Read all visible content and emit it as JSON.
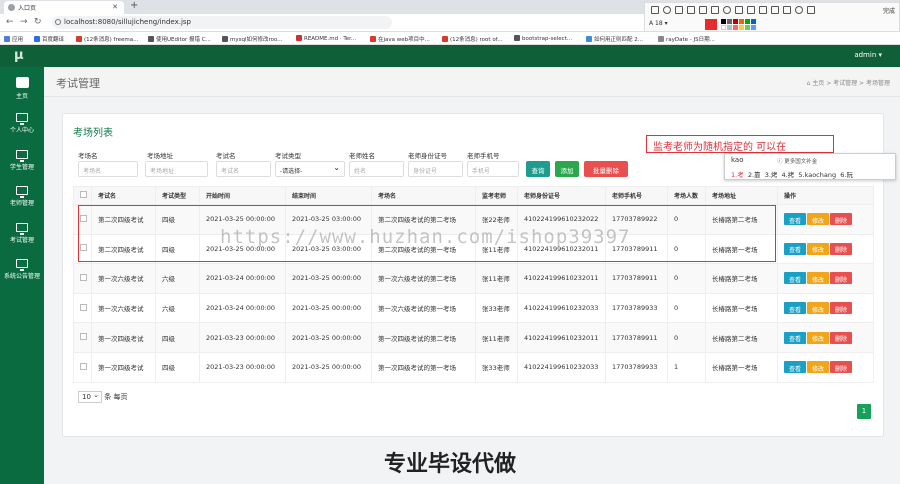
{
  "browser": {
    "tab_title": "入口页",
    "url": "localhost:8080/sillujicheng/index.jsp",
    "bookmarks": [
      "应用",
      "百度翻译",
      "(12条消息) freema...",
      "使用UEditor 报错 C...",
      "mysql如何修改roo...",
      "README.md · Ter...",
      "在java web项目中...",
      "(12条消息) root of...",
      "bootstrap-select...",
      "如何用正则匹配 2...",
      "rayDate - JS日期..."
    ]
  },
  "annotation_toolbar": {
    "font_size": "18",
    "done_label": "完成",
    "color": "#e52b2b"
  },
  "header": {
    "logo": "μ",
    "user": "admin ▾"
  },
  "sidebar": {
    "items": [
      {
        "label": "主页"
      },
      {
        "label": "个人中心"
      },
      {
        "label": "学生管理"
      },
      {
        "label": "老师管理"
      },
      {
        "label": "考试管理"
      },
      {
        "label": "系统公告管理"
      }
    ]
  },
  "page": {
    "title": "考试管理",
    "breadcrumb": "⌂ 主页  >  考试管理  >  考场管理"
  },
  "panel": {
    "title": "考场列表",
    "filters": [
      {
        "label": "考场名",
        "placeholder": "考场名"
      },
      {
        "label": "考场地址",
        "placeholder": "考场地址"
      },
      {
        "label": "考试名",
        "placeholder": "考试名"
      },
      {
        "label": "考试类型",
        "value": "-请选择-"
      },
      {
        "label": "老师姓名",
        "placeholder": "姓名"
      },
      {
        "label": "老师身份证号",
        "placeholder": "身份证号"
      },
      {
        "label": "老师手机号",
        "placeholder": "手机号"
      }
    ],
    "buttons": {
      "search": "查询",
      "add": "添加",
      "batch_delete": "批量删除"
    },
    "columns": [
      "",
      "考试名",
      "考试类型",
      "开始时间",
      "结束时间",
      "考场名",
      "监考老师",
      "老师身份证号",
      "老师手机号",
      "考场人数",
      "考场地址",
      "操作"
    ],
    "rows": [
      [
        "第二次四级考试",
        "四级",
        "2021-03-25 00:00:00",
        "2021-03-25 03:00:00",
        "第二次四级考试的第二考场",
        "张22老师",
        "410224199610232022",
        "17703789922",
        "0",
        "长椿路第二考场"
      ],
      [
        "第二次四级考试",
        "四级",
        "2021-03-25 00:00:00",
        "2021-03-25 03:00:00",
        "第二次四级考试的第一考场",
        "张11老师",
        "410224199610232011",
        "17703789911",
        "0",
        "长椿路第一考场"
      ],
      [
        "第一次六级考试",
        "六级",
        "2021-03-24 00:00:00",
        "2021-03-25 00:00:00",
        "第一次六级考试的第二考场",
        "张11老师",
        "410224199610232011",
        "17703789911",
        "0",
        "长椿路第二考场"
      ],
      [
        "第一次六级考试",
        "六级",
        "2021-03-24 00:00:00",
        "2021-03-25 00:00:00",
        "第一次六级考试的第一考场",
        "张33老师",
        "410224199610232033",
        "17703789933",
        "0",
        "长椿路第一考场"
      ],
      [
        "第一次四级考试",
        "四级",
        "2021-03-23 00:00:00",
        "2021-03-25 00:00:00",
        "第一次四级考试的第二考场",
        "张11老师",
        "410224199610232011",
        "17703789911",
        "0",
        "长椿路第二考场"
      ],
      [
        "第一次四级考试",
        "四级",
        "2021-03-23 00:00:00",
        "2021-03-25 00:00:00",
        "第一次四级考试的第一考场",
        "张33老师",
        "410224199610232033",
        "17703789933",
        "1",
        "长椿路第一考场"
      ]
    ],
    "row_actions": {
      "view": "查看",
      "edit": "修改",
      "delete": "删除"
    },
    "page_size": "10",
    "page_size_suffix": "条 每页",
    "current_page": "1"
  },
  "overlay": {
    "note": "监考老师为随机指定的  可以在",
    "ime_input": "kao",
    "ime_hint": "ⓘ 更多国文补金",
    "ime_candidates": [
      "1.考",
      "2.靠",
      "3.烤",
      "4.拷",
      "5.kaochang",
      "6.阮"
    ]
  },
  "watermark": "https://www.huzhan.com/ishop39397",
  "footer_ad": "专业毕设代做",
  "colors": {
    "brand": "#0b6b40",
    "search": "#1f9c8f",
    "add": "#2aa84b",
    "danger": "#e94f4f",
    "edit": "#f0a51a",
    "view": "#1ba0c5"
  }
}
